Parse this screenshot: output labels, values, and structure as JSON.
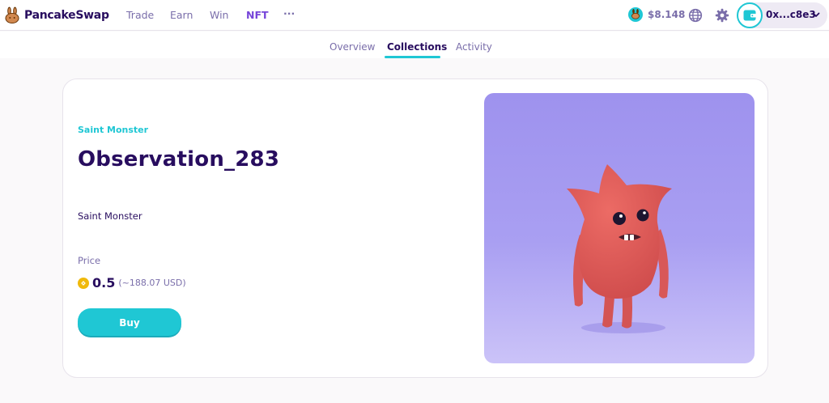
{
  "brand": {
    "name": "PancakeSwap"
  },
  "nav": {
    "items": [
      {
        "label": "Trade"
      },
      {
        "label": "Earn"
      },
      {
        "label": "Win"
      },
      {
        "label": "NFT"
      },
      {
        "label": "···"
      }
    ],
    "active": "NFT"
  },
  "header": {
    "cake_price": "$8.148",
    "wallet_address": "0x...c8e3",
    "icons": [
      "cake-token-icon",
      "globe-icon",
      "gear-icon",
      "wallet-icon",
      "chevron-down-icon"
    ]
  },
  "subnav": {
    "items": [
      {
        "label": "Overview"
      },
      {
        "label": "Collections"
      },
      {
        "label": "Activity"
      }
    ],
    "active": "Collections"
  },
  "nft": {
    "collection": "Saint Monster",
    "title": "Observation_283",
    "description": "Saint Monster",
    "price_label": "Price",
    "price": "0.5",
    "price_usd": "(~188.07 USD)",
    "buy_label": "Buy",
    "image_icon": "nft-image"
  },
  "colors": {
    "primary": "#1fc7d4",
    "secondary": "#7645d9",
    "text": "#280d5f",
    "text_subtle": "#7a6eaa",
    "background": "#faf9fa",
    "image_bg": "#a89ef0",
    "monster": "#e8635e"
  }
}
